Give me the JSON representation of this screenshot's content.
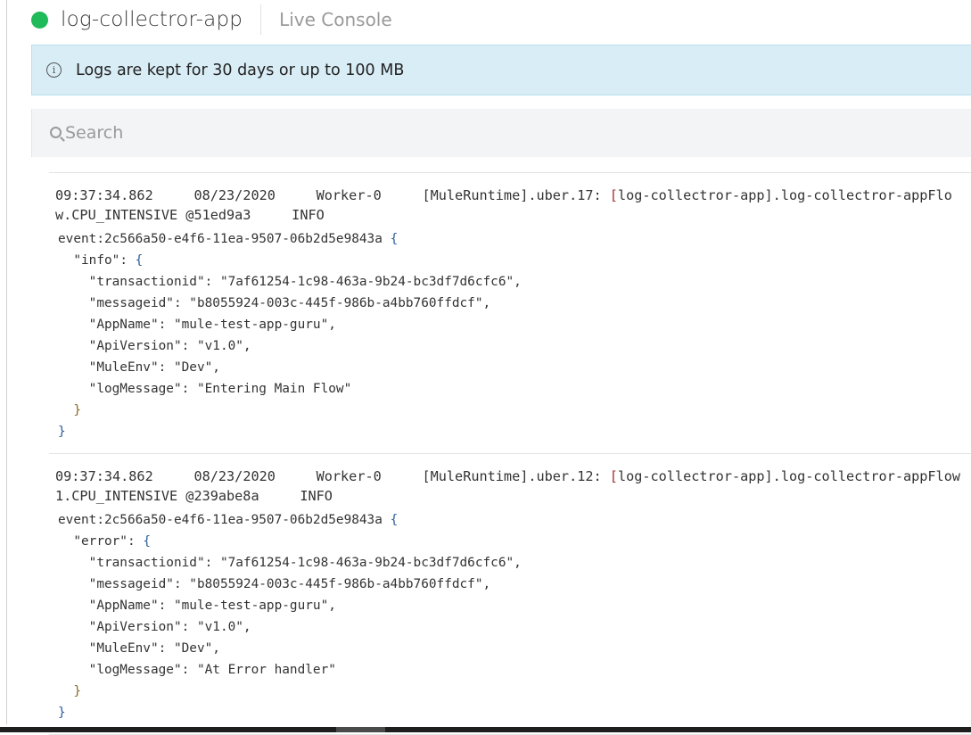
{
  "header": {
    "app_name": "log-collectror-app",
    "section": "Live Console",
    "status_color": "#1fba5a"
  },
  "banner": {
    "icon": "info-icon",
    "text": "Logs are kept for 30 days or up to 100 MB"
  },
  "search": {
    "placeholder": "Search",
    "value": ""
  },
  "entries": [
    {
      "time": "09:37:34.862",
      "date": "08/23/2020",
      "worker": "Worker-0",
      "thread": "[MuleRuntime].uber.17: ",
      "category_open": "[",
      "category": "log-collectror-app].log-collectror-appFlow.CPU_INTENSIVE @51ed9a3",
      "level": "INFO",
      "event": "event:2c566a50-e4f6-11ea-9507-06b2d5e9843a",
      "key": "\"info\"",
      "fields": [
        "\"transactionid\": \"7af61254-1c98-463a-9b24-bc3df7d6cfc6\",",
        "\"messageid\": \"b8055924-003c-445f-986b-a4bb760ffdcf\",",
        "\"AppName\": \"mule-test-app-guru\",",
        "\"ApiVersion\": \"v1.0\",",
        "\"MuleEnv\": \"Dev\",",
        "\"logMessage\": \"Entering Main Flow\""
      ]
    },
    {
      "time": "09:37:34.862",
      "date": "08/23/2020",
      "worker": "Worker-0",
      "thread": "[MuleRuntime].uber.12: ",
      "category_open": "[",
      "category": "log-collectror-app].log-collectror-appFlow1.CPU_INTENSIVE @239abe8a",
      "level": "INFO",
      "event": "event:2c566a50-e4f6-11ea-9507-06b2d5e9843a",
      "key": "\"error\"",
      "fields": [
        "\"transactionid\": \"7af61254-1c98-463a-9b24-bc3df7d6cfc6\",",
        "\"messageid\": \"b8055924-003c-445f-986b-a4bb760ffdcf\",",
        "\"AppName\": \"mule-test-app-guru\",",
        "\"ApiVersion\": \"v1.0\",",
        "\"MuleEnv\": \"Dev\",",
        "\"logMessage\": \"At Error handler\""
      ]
    }
  ]
}
